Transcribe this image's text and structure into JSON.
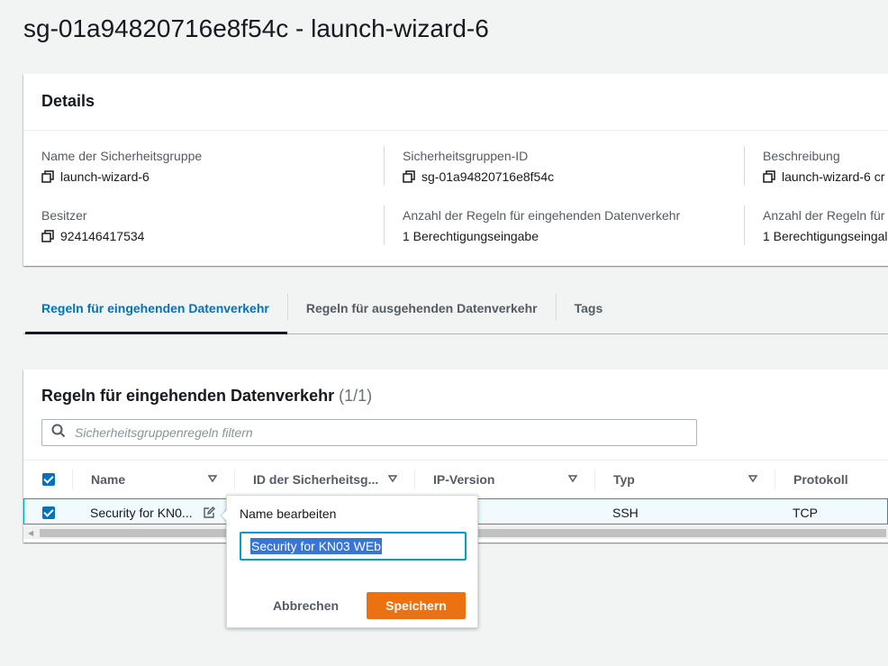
{
  "page": {
    "title": "sg-01a94820716e8f54c - launch-wizard-6"
  },
  "details": {
    "header": "Details",
    "fields": [
      {
        "label": "Name der Sicherheitsgruppe",
        "value": "launch-wizard-6",
        "copy": true
      },
      {
        "label": "Sicherheitsgruppen-ID",
        "value": "sg-01a94820716e8f54c",
        "copy": true
      },
      {
        "label": "Beschreibung",
        "value": "launch-wizard-6 cr",
        "copy": true
      },
      {
        "label": "Besitzer",
        "value": "924146417534",
        "copy": true
      },
      {
        "label": "Anzahl der Regeln für eingehenden Datenverkehr",
        "value": "1 Berechtigungseingabe",
        "copy": false
      },
      {
        "label": "Anzahl der Regeln für",
        "value": "1 Berechtigungseingal",
        "copy": false
      }
    ]
  },
  "tabs": [
    {
      "label": "Regeln für eingehenden Datenverkehr",
      "active": true
    },
    {
      "label": "Regeln für ausgehenden Datenverkehr",
      "active": false
    },
    {
      "label": "Tags",
      "active": false
    }
  ],
  "rules": {
    "title": "Regeln für eingehenden Datenverkehr",
    "count": "(1/1)",
    "filter_placeholder": "Sicherheitsgruppenregeln filtern",
    "columns": [
      "Name",
      "ID der Sicherheitsg...",
      "IP-Version",
      "Typ",
      "Protokoll"
    ],
    "row": {
      "name": "Security for KN0...",
      "id": "",
      "ip_version": "",
      "type": "SSH",
      "protocol": "TCP"
    }
  },
  "popover": {
    "label": "Name bearbeiten",
    "input_value": "Security for KN03 WEb",
    "cancel_label": "Abbrechen",
    "save_label": "Speichern"
  },
  "colors": {
    "accent": "#0073bb",
    "primary_button": "#ec7211",
    "selection": "#3875d7"
  }
}
